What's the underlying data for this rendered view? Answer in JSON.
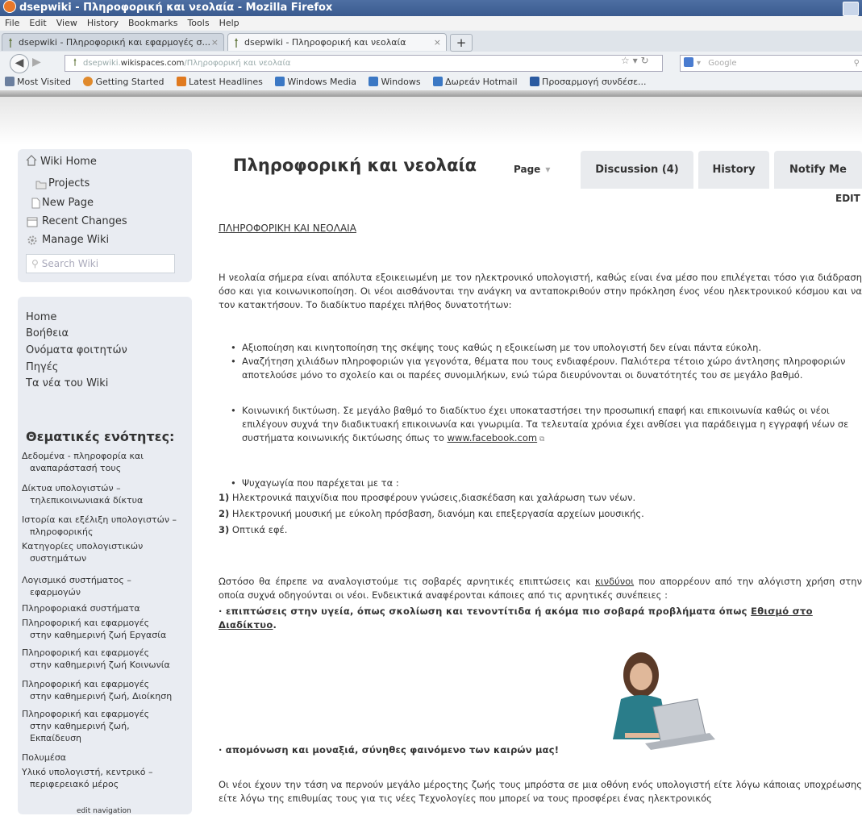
{
  "window": {
    "title": "dsepwiki - Πληροφορική και νεολαία - Mozilla Firefox"
  },
  "menu": [
    "File",
    "Edit",
    "View",
    "History",
    "Bookmarks",
    "Tools",
    "Help"
  ],
  "tabs": [
    {
      "label": "dsepwiki - Πληροφορική και εφαρμογές σ...",
      "close": "×"
    },
    {
      "label": "dsepwiki - Πληροφορική και νεολαία",
      "close": "×"
    }
  ],
  "new_tab_label": "+",
  "address": {
    "prefix": "dsepwiki.",
    "host": "wikispaces.com",
    "path": "/Πληροφορική και νεολαία"
  },
  "search": {
    "placeholder": "Google"
  },
  "bookmarks": [
    {
      "label": "Most Visited",
      "color": "#6b7f9e"
    },
    {
      "label": "Getting Started",
      "color": "#e08a2c"
    },
    {
      "label": "Latest Headlines",
      "color": "#e07a1f"
    },
    {
      "label": "Windows Media",
      "color": "#3b78c4"
    },
    {
      "label": "Windows",
      "color": "#3b78c4"
    },
    {
      "label": "Δωρεάν Hotmail",
      "color": "#3b78c4"
    },
    {
      "label": "Προσαρμογή συνδέσε...",
      "color": "#2a5aa0"
    }
  ],
  "sidebar": {
    "wiki_links": [
      "Wiki Home",
      "Projects",
      "New Page",
      "Recent Changes",
      "Manage Wiki"
    ],
    "search_placeholder": "Search Wiki",
    "nav": [
      "Home",
      "Βοήθεια",
      "Ονόματα φοιτητών",
      "Πηγές",
      "Τα νέα του Wiki"
    ],
    "thematic_heading": "Θεματικές ενότητες:",
    "thematic": [
      [
        "Δεδομένα - πληροφορία και",
        "αναπαράστασή τους"
      ],
      [
        "Δίκτυα υπολογιστών –",
        "τηλεπικοινωνιακά δίκτυα"
      ],
      [
        "Ιστορία και εξέλιξη υπολογιστών –",
        "πληροφορικής"
      ],
      [
        "Κατηγορίες υπολογιστικών",
        "συστημάτων"
      ],
      [
        "Λογισμικό συστήματος –",
        "εφαρμογών"
      ],
      [
        "Πληροφοριακά συστήματα"
      ],
      [
        "Πληροφορική και εφαρμογές",
        "στην καθημερινή ζωή Εργασία"
      ],
      [
        "Πληροφορική και εφαρμογές",
        "στην καθημερινή ζωή Κοινωνία"
      ],
      [
        "Πληροφορική και εφαρμογές",
        "στην καθημερινή ζωή, Διοίκηση"
      ],
      [
        "Πληροφορική και εφαρμογές",
        "στην καθημερινή ζωή,",
        "Εκπαίδευση"
      ],
      [
        "Πολυμέσα"
      ],
      [
        "Υλικό υπολογιστή, κεντρικό –",
        "περιφερειακό μέρος"
      ]
    ],
    "edit_navigation": "edit navigation"
  },
  "page": {
    "title": "Πληροφορική και νεολαία",
    "tab_page": "Page",
    "tab_discussion": "Discussion (4)",
    "tab_history": "History",
    "tab_notify": "Notify Me",
    "edit": "EDIT",
    "heading": "ΠΛΗΡΟΦΟΡΙΚΗ ΚΑΙ ΝΕΟΛΑΙΑ",
    "intro": "Η νεολαία σήμερα είναι απόλυτα εξοικειωμένη με τον ηλεκτρονικό υπολογιστή, καθώς είναι ένα μέσο που επιλέγεται τόσο για διάδραση όσο και για κοινωνικοποίηση. Οι νέοι αισθάνονται την ανάγκη να ανταποκριθούν στην πρόκληση ένος νέου ηλεκτρονικού κόσμου και να τον κατακτήσουν. Το διαδίκτυο παρέχει πλήθος δυνατοτήτων:",
    "bullet1": "Αξιοποίηση και κινητοποίηση της σκέψης τους καθώς η εξοικείωση με τον υπολογιστή δεν είναι πάντα εύκολη.",
    "bullet2": "Αναζήτηση χιλιάδων πληροφοριών για γεγονότα, θέματα που τους ενδιαφέρουν. Παλιότερα τέτοιο χώρο άντλησης πληροφοριών αποτελούσε μόνο το σχολείο και οι παρέες συνομιλήκων, ενώ τώρα διευρύνονται οι δυνατότητές του σε μεγάλο βαθμό.",
    "bullet3_text": "Κοινωνική δικτύωση. Σε μεγάλο βαθμό το διαδίκτυο έχει υποκαταστήσει την προσωπική επαφή και επικοινωνία καθώς οι νέοι επιλέγουν συχνά την διαδικτυακή επικοινωνία και γνωριμία. Τα τελευταία χρόνια έχει ανθίσει για παράδειγμα η εγγραφή νέων σε συστήματα κοινωνικής δικτύωσης όπως το",
    "bullet3_link": "www.facebook.com",
    "bullet4": "Ψυχαγωγία που παρέχεται με τα :",
    "num1": "1)",
    "item1": "Ηλεκτρονικά παιχνίδια που προσφέρουν γνώσεις,διασκέδαση και χαλάρωση των νέων.",
    "num2": "2)",
    "item2": "Ηλεκτρονική μουσική με εύκολη πρόσβαση, διανόμη και επεξεργασία αρχείων μουσικής.",
    "num3": "3)",
    "item3": "Οπτικά εφέ.",
    "para2_a": "Ωστόσο θα έπρεπε να αναλογιστούμε τις σοβαρές αρνητικές επιπτώσεις και",
    "para2_link": "κινδύνοι",
    "para2_b": "που απορρέουν από την αλόγιστη χρήση στην οποία συχνά οδηγούνται οι νέοι. Ενδεικτικά αναφέρονται κάποιες από τις αρνητικές συνέπειες :",
    "bold1_text": "· επιπτώσεις στην υγεία, όπως σκολίωση και τενοντίτιδα ή ακόμα πιο σοβαρά προβλήματα όπως",
    "bold1_link": "Εθισμό στο Διαδίκτυο",
    "bold1_end": ".",
    "bold2": "· απομόνωση και μοναξιά, σύνηθες φαινόμενο των καιρών μας!",
    "final": "Οι νέοι έχουν την τάση να περνούν μεγάλο μέροςτης ζωής τους μπρόστα σε μια οθόνη ενός υπολογιστή είτε λόγω κάποιας υποχρέωσης είτε λόγω της επιθυμίας τους για τις νέες Τεχνολογίες που μπορεί να τους προσφέρει ένας ηλεκτρονικός"
  },
  "colors": {
    "titlebar": "#3a5a8e",
    "sidebar_bg": "#e9ecf2",
    "tab_bg": "#e9ebee"
  }
}
